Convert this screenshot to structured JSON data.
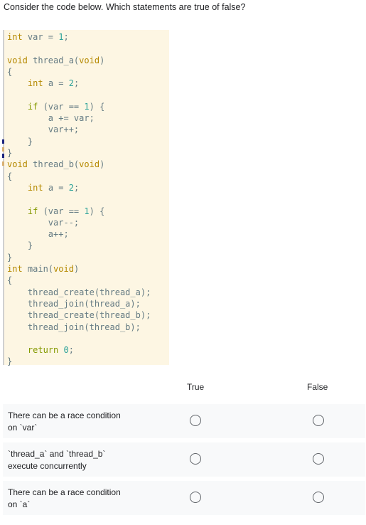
{
  "question": {
    "title": "Consider the code below. Which statements are true of false?"
  },
  "code": {
    "lines": [
      [
        {
          "t": "int",
          "c": "kw-type"
        },
        {
          "t": " var = ",
          "c": ""
        },
        {
          "t": "1",
          "c": "num"
        },
        {
          "t": ";",
          "c": ""
        }
      ],
      [],
      [
        {
          "t": "void",
          "c": "kw-type"
        },
        {
          "t": " thread_a(",
          "c": ""
        },
        {
          "t": "void",
          "c": "kw-type"
        },
        {
          "t": ")",
          "c": ""
        }
      ],
      [
        {
          "t": "{",
          "c": ""
        }
      ],
      [
        {
          "t": "    ",
          "c": ""
        },
        {
          "t": "int",
          "c": "kw-type"
        },
        {
          "t": " a = ",
          "c": ""
        },
        {
          "t": "2",
          "c": "num"
        },
        {
          "t": ";",
          "c": ""
        }
      ],
      [],
      [
        {
          "t": "    ",
          "c": ""
        },
        {
          "t": "if",
          "c": "kw-flow"
        },
        {
          "t": " (var == ",
          "c": ""
        },
        {
          "t": "1",
          "c": "num"
        },
        {
          "t": ") {",
          "c": ""
        }
      ],
      [
        {
          "t": "        a += var;",
          "c": ""
        }
      ],
      [
        {
          "t": "        var++;",
          "c": ""
        }
      ],
      [
        {
          "t": "    }",
          "c": ""
        }
      ],
      [
        {
          "t": "}",
          "c": ""
        }
      ],
      [
        {
          "t": "void",
          "c": "kw-type"
        },
        {
          "t": " thread_b(",
          "c": ""
        },
        {
          "t": "void",
          "c": "kw-type"
        },
        {
          "t": ")",
          "c": ""
        }
      ],
      [
        {
          "t": "{",
          "c": ""
        }
      ],
      [
        {
          "t": "    ",
          "c": ""
        },
        {
          "t": "int",
          "c": "kw-type"
        },
        {
          "t": " a = ",
          "c": ""
        },
        {
          "t": "2",
          "c": "num"
        },
        {
          "t": ";",
          "c": ""
        }
      ],
      [],
      [
        {
          "t": "    ",
          "c": ""
        },
        {
          "t": "if",
          "c": "kw-flow"
        },
        {
          "t": " (var == ",
          "c": ""
        },
        {
          "t": "1",
          "c": "num"
        },
        {
          "t": ") {",
          "c": ""
        }
      ],
      [
        {
          "t": "        var--;",
          "c": ""
        }
      ],
      [
        {
          "t": "        a++;",
          "c": ""
        }
      ],
      [
        {
          "t": "    }",
          "c": ""
        }
      ],
      [
        {
          "t": "}",
          "c": ""
        }
      ],
      [
        {
          "t": "int",
          "c": "kw-type"
        },
        {
          "t": " main(",
          "c": ""
        },
        {
          "t": "void",
          "c": "kw-type"
        },
        {
          "t": ")",
          "c": ""
        }
      ],
      [
        {
          "t": "{",
          "c": ""
        }
      ],
      [
        {
          "t": "    thread_create(thread_a);",
          "c": ""
        }
      ],
      [
        {
          "t": "    thread_join(thread_a);",
          "c": ""
        }
      ],
      [
        {
          "t": "    thread_create(thread_b);",
          "c": ""
        }
      ],
      [
        {
          "t": "    thread_join(thread_b);",
          "c": ""
        }
      ],
      [],
      [
        {
          "t": "    ",
          "c": ""
        },
        {
          "t": "return",
          "c": "kw-flow"
        },
        {
          "t": " ",
          "c": ""
        },
        {
          "t": "0",
          "c": "num"
        },
        {
          "t": ";",
          "c": ""
        }
      ],
      [
        {
          "t": "}",
          "c": ""
        }
      ]
    ]
  },
  "grid": {
    "columns": [
      "True",
      "False"
    ],
    "rows": [
      {
        "label": "There can be a race condition on `var`"
      },
      {
        "label": "`thread_a` and `thread_b` execute concurrently"
      },
      {
        "label": "There can be a race condition on `a`"
      }
    ]
  }
}
